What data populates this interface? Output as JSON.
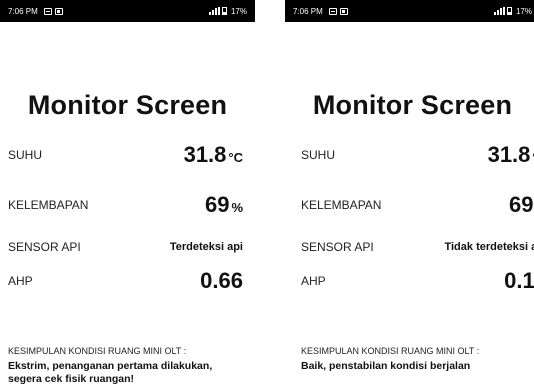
{
  "screens": [
    {
      "status": {
        "time": "7:06 PM",
        "battery": "17%"
      },
      "title": "Monitor Screen",
      "suhu": {
        "label": "SUHU",
        "value": "31.8",
        "unit": "°C"
      },
      "kelembapan": {
        "label": "KELEMBAPAN",
        "value": "69",
        "unit": "%"
      },
      "sensor_api": {
        "label": "SENSOR API",
        "value": "Terdeteksi api"
      },
      "ahp": {
        "label": "AHP",
        "value": "0.66"
      },
      "conclusion": {
        "label": "KESIMPULAN KONDISI RUANG MINI OLT :",
        "text": "Ekstrim, penanganan pertama dilakukan, segera cek fisik ruangan!"
      }
    },
    {
      "status": {
        "time": "7:06 PM",
        "battery": "17%"
      },
      "title": "Monitor Screen",
      "suhu": {
        "label": "SUHU",
        "value": "31.8",
        "unit": "°C"
      },
      "kelembapan": {
        "label": "KELEMBAPAN",
        "value": "69",
        "unit": "%"
      },
      "sensor_api": {
        "label": "SENSOR API",
        "value": "Tidak terdeteksi api"
      },
      "ahp": {
        "label": "AHP",
        "value": "0.13"
      },
      "conclusion": {
        "label": "KESIMPULAN KONDISI RUANG MINI OLT :",
        "text": "Baik, penstabilan kondisi berjalan"
      }
    }
  ]
}
